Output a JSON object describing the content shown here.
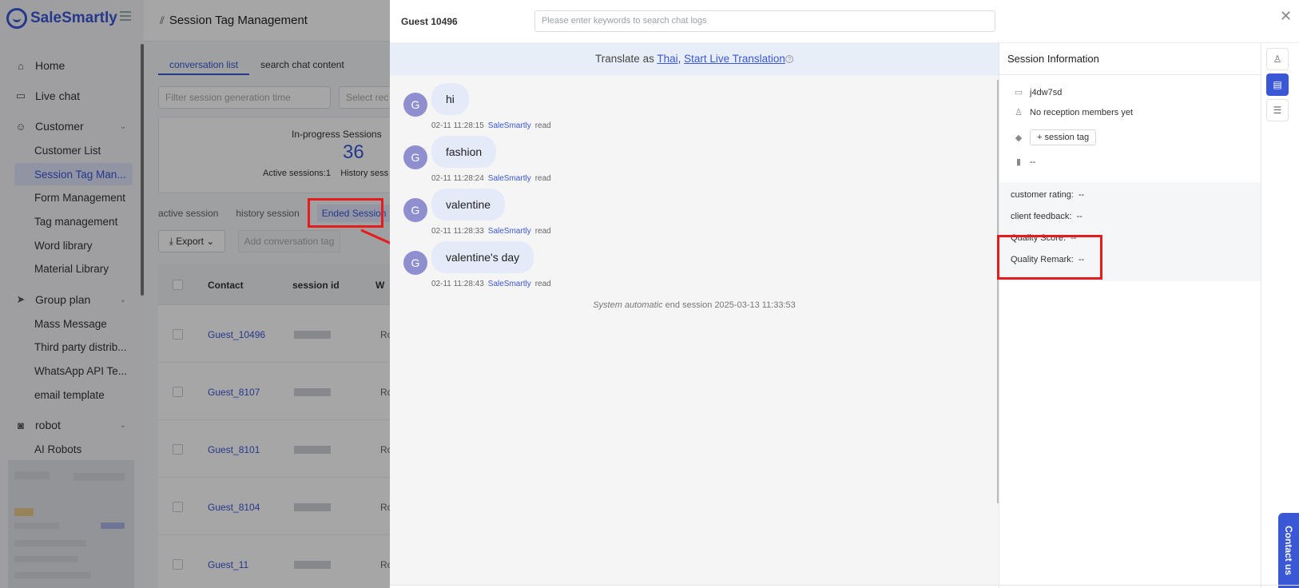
{
  "app": {
    "brand": "SaleSmartly"
  },
  "sidebar": {
    "items": [
      {
        "label": "Home",
        "icon": "home-icon"
      },
      {
        "label": "Live chat",
        "icon": "chat-icon"
      },
      {
        "label": "Customer",
        "icon": "customer-icon"
      },
      {
        "label": "Customer List"
      },
      {
        "label": "Session Tag Man..."
      },
      {
        "label": "Form Management"
      },
      {
        "label": "Tag management"
      },
      {
        "label": "Word library"
      },
      {
        "label": "Material Library"
      },
      {
        "label": "Group plan",
        "icon": "send-icon"
      },
      {
        "label": "Mass Message"
      },
      {
        "label": "Third party distrib..."
      },
      {
        "label": "WhatsApp API Te..."
      },
      {
        "label": "email template"
      },
      {
        "label": "robot",
        "icon": "robot-icon"
      },
      {
        "label": "AI Robots"
      }
    ]
  },
  "main": {
    "title": "Session Tag Management",
    "tabs": [
      "conversation list",
      "search chat content"
    ],
    "filter_time_placeholder": "Filter session generation time",
    "filter_select_placeholder": "Select rec",
    "stats": {
      "in_progress_label": "In-progress Sessions",
      "in_progress_count": "36",
      "active_line": "Active sessions:1",
      "history_line": "History sess"
    },
    "session_tabs": [
      "active session",
      "history session",
      "Ended Session"
    ],
    "export_label": "Export",
    "add_tag_label": "Add conversation tag",
    "columns": [
      "Contact",
      "session id",
      "W"
    ],
    "rows": [
      {
        "contact": "Guest_10496",
        "ro": "Ro"
      },
      {
        "contact": "Guest_8107",
        "ro": "Ro"
      },
      {
        "contact": "Guest_8101",
        "ro": "Ro"
      },
      {
        "contact": "Guest_8104",
        "ro": "Ro"
      },
      {
        "contact": "Guest_11",
        "ro": "Ro"
      }
    ]
  },
  "chat": {
    "guest_title": "Guest  10496",
    "search_placeholder": "Please enter keywords to search chat logs",
    "translate_prefix": "Translate as ",
    "translate_lang": "Thai",
    "translate_sep": ", ",
    "translate_action": "Start Live Translation",
    "messages": [
      {
        "avatar": "G",
        "text": "hi",
        "time": "02-11 11:28:15",
        "agent": "SaleSmartly",
        "status": "read"
      },
      {
        "avatar": "G",
        "text": "fashion",
        "time": "02-11 11:28:24",
        "agent": "SaleSmartly",
        "status": "read"
      },
      {
        "avatar": "G",
        "text": "valentine",
        "time": "02-11 11:28:33",
        "agent": "SaleSmartly",
        "status": "read"
      },
      {
        "avatar": "G",
        "text": "valentine's day",
        "time": "02-11 11:28:43",
        "agent": "SaleSmartly",
        "status": "read"
      }
    ],
    "system_end_italic": "System automatic",
    "system_end_rest": " end session 2025-03-13 11:33:53"
  },
  "info": {
    "title": "Session Information",
    "session_code": "j4dw7sd",
    "reception": "No reception members yet",
    "tag_button": "+ session tag",
    "bookmark_value": "--",
    "customer_rating_label": "customer rating:",
    "customer_rating_value": "--",
    "client_feedback_label": "client feedback:",
    "client_feedback_value": "--",
    "quality_score_label": "Quality Score:",
    "quality_score_value": "--",
    "quality_remark_label": "Quality Remark:",
    "quality_remark_value": "--"
  },
  "contact_us": "Contact us",
  "colors": {
    "accent": "#3a57d6",
    "highlight": "#e61b1b",
    "avatar": "#8f8fcf"
  }
}
